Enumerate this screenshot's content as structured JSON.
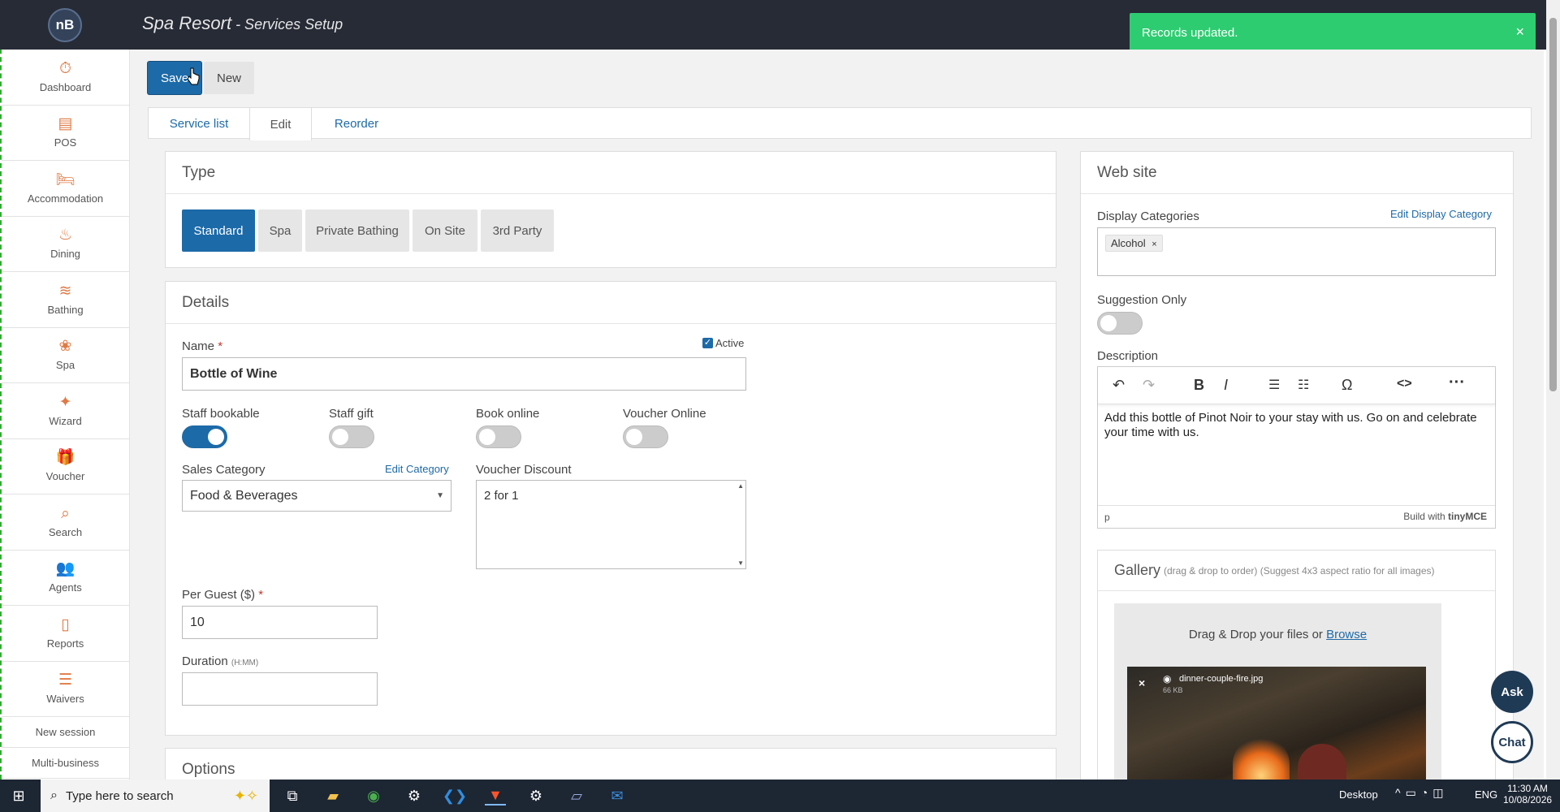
{
  "app": {
    "logo": "nB",
    "title": "Spa Resort",
    "subtitle": " - Services Setup"
  },
  "toast": {
    "message": "Records updated.",
    "close": "×"
  },
  "sidebar": {
    "items": [
      {
        "label": "Dashboard",
        "icon": "⏱"
      },
      {
        "label": "POS",
        "icon": "▤"
      },
      {
        "label": "Accommodation",
        "icon": "🛏"
      },
      {
        "label": "Dining",
        "icon": "♨"
      },
      {
        "label": "Bathing",
        "icon": "≋"
      },
      {
        "label": "Spa",
        "icon": "❀"
      },
      {
        "label": "Wizard",
        "icon": "✦"
      },
      {
        "label": "Voucher",
        "icon": "🎁"
      },
      {
        "label": "Search",
        "icon": "⌕"
      },
      {
        "label": "Agents",
        "icon": "👥"
      },
      {
        "label": "Reports",
        "icon": "▯"
      },
      {
        "label": "Waivers",
        "icon": "☰"
      }
    ],
    "links": [
      "New session",
      "Multi-business"
    ]
  },
  "toolbar": {
    "save": "Save",
    "new": "New"
  },
  "tabs": [
    "Service list",
    "Edit",
    "Reorder"
  ],
  "type_panel": {
    "title": "Type",
    "options": [
      "Standard",
      "Spa",
      "Private Bathing",
      "On Site",
      "3rd Party"
    ],
    "selected": "Standard"
  },
  "details": {
    "title": "Details",
    "name_label": "Name",
    "name_value": "Bottle of Wine",
    "active_label": "Active",
    "active": true,
    "toggles": [
      {
        "label": "Staff bookable",
        "on": true
      },
      {
        "label": "Staff gift",
        "on": false
      },
      {
        "label": "Book online",
        "on": false
      },
      {
        "label": "Voucher Online",
        "on": false
      }
    ],
    "sales_category_label": "Sales Category",
    "sales_category_value": "Food & Beverages",
    "edit_category": "Edit Category",
    "voucher_discount_label": "Voucher Discount",
    "voucher_discount_value": "2 for 1",
    "per_guest_label": "Per Guest ($)",
    "per_guest_value": "10",
    "duration_label": "Duration",
    "duration_hint": "(H:MM)",
    "duration_value": ""
  },
  "options_title": "Options",
  "website": {
    "title": "Web site",
    "display_categories_label": "Display Categories",
    "edit_display_category": "Edit Display Category",
    "category_tag": "Alcohol",
    "suggestion_only_label": "Suggestion Only",
    "suggestion_only": false,
    "description_label": "Description",
    "description_text": "Add this bottle of Pinot Noir to your stay with us. Go on and celebrate your time with us.",
    "editor_path": "p",
    "editor_brand": "Build with",
    "editor_brand_name": "tinyMCE",
    "gallery_title": "Gallery",
    "gallery_hint": "(drag & drop to order) (Suggest 4x3 aspect ratio for all images)",
    "drop_text": "Drag & Drop your files or ",
    "browse": "Browse",
    "image_name": "dinner-couple-fire.jpg",
    "image_size": "66 KB"
  },
  "fab": {
    "ask": "Ask",
    "chat": "Chat"
  },
  "taskbar": {
    "search_placeholder": "Type here to search",
    "desktop": "Desktop",
    "lang": "ENG",
    "time": "11:30 AM",
    "date": "10/08/2026"
  }
}
